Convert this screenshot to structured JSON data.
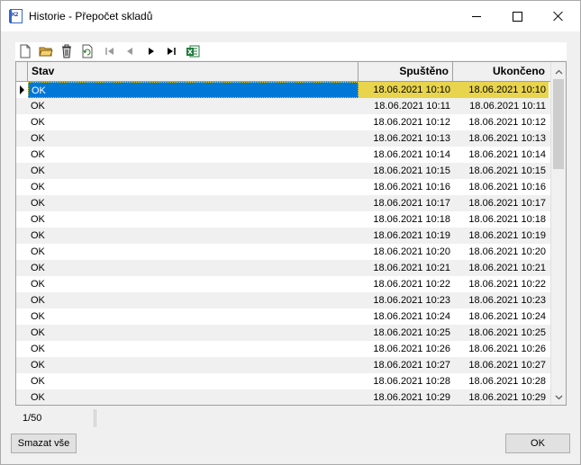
{
  "window": {
    "title": "Historie - Přepočet skladů",
    "app_icon_text": "K2"
  },
  "toolbar": {
    "buttons": [
      "new-document-icon",
      "open-folder-icon",
      "delete-icon",
      "refresh-icon",
      "first-record-icon",
      "prev-record-icon",
      "next-record-icon",
      "last-record-icon",
      "excel-export-icon"
    ]
  },
  "grid": {
    "columns": [
      "Stav",
      "Spuštěno",
      "Ukončeno"
    ],
    "rows": [
      {
        "stav": "OK",
        "spusteno": "18.06.2021 10:10",
        "ukonceno": "18.06.2021 10:10"
      },
      {
        "stav": "OK",
        "spusteno": "18.06.2021 10:11",
        "ukonceno": "18.06.2021 10:11"
      },
      {
        "stav": "OK",
        "spusteno": "18.06.2021 10:12",
        "ukonceno": "18.06.2021 10:12"
      },
      {
        "stav": "OK",
        "spusteno": "18.06.2021 10:13",
        "ukonceno": "18.06.2021 10:13"
      },
      {
        "stav": "OK",
        "spusteno": "18.06.2021 10:14",
        "ukonceno": "18.06.2021 10:14"
      },
      {
        "stav": "OK",
        "spusteno": "18.06.2021 10:15",
        "ukonceno": "18.06.2021 10:15"
      },
      {
        "stav": "OK",
        "spusteno": "18.06.2021 10:16",
        "ukonceno": "18.06.2021 10:16"
      },
      {
        "stav": "OK",
        "spusteno": "18.06.2021 10:17",
        "ukonceno": "18.06.2021 10:17"
      },
      {
        "stav": "OK",
        "spusteno": "18.06.2021 10:18",
        "ukonceno": "18.06.2021 10:18"
      },
      {
        "stav": "OK",
        "spusteno": "18.06.2021 10:19",
        "ukonceno": "18.06.2021 10:19"
      },
      {
        "stav": "OK",
        "spusteno": "18.06.2021 10:20",
        "ukonceno": "18.06.2021 10:20"
      },
      {
        "stav": "OK",
        "spusteno": "18.06.2021 10:21",
        "ukonceno": "18.06.2021 10:21"
      },
      {
        "stav": "OK",
        "spusteno": "18.06.2021 10:22",
        "ukonceno": "18.06.2021 10:22"
      },
      {
        "stav": "OK",
        "spusteno": "18.06.2021 10:23",
        "ukonceno": "18.06.2021 10:23"
      },
      {
        "stav": "OK",
        "spusteno": "18.06.2021 10:24",
        "ukonceno": "18.06.2021 10:24"
      },
      {
        "stav": "OK",
        "spusteno": "18.06.2021 10:25",
        "ukonceno": "18.06.2021 10:25"
      },
      {
        "stav": "OK",
        "spusteno": "18.06.2021 10:26",
        "ukonceno": "18.06.2021 10:26"
      },
      {
        "stav": "OK",
        "spusteno": "18.06.2021 10:27",
        "ukonceno": "18.06.2021 10:27"
      },
      {
        "stav": "OK",
        "spusteno": "18.06.2021 10:28",
        "ukonceno": "18.06.2021 10:28"
      },
      {
        "stav": "OK",
        "spusteno": "18.06.2021 10:29",
        "ukonceno": "18.06.2021 10:29"
      }
    ],
    "selected_row": 0
  },
  "status": {
    "position": "1/50"
  },
  "buttons": {
    "delete_all": "Smazat vše",
    "ok": "OK"
  },
  "colors": {
    "selection_blue": "#0078d7",
    "highlight_yellow": "#e8d44d"
  }
}
